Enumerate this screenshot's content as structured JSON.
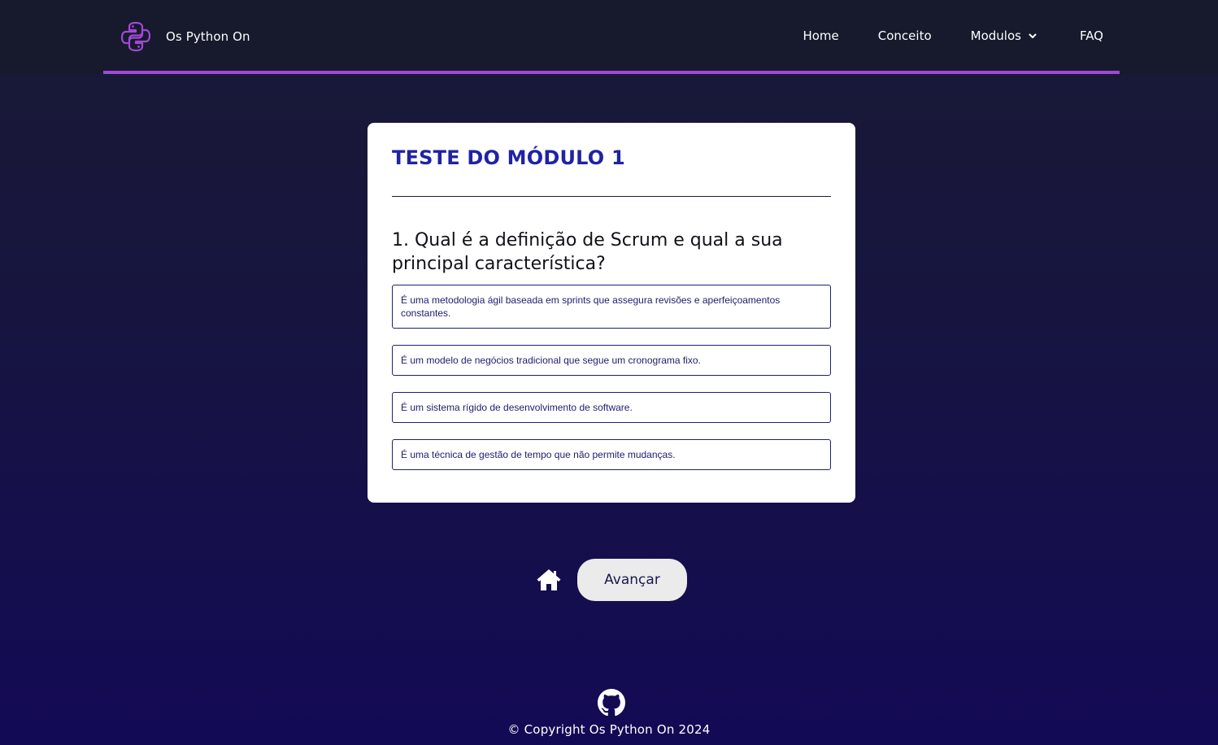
{
  "header": {
    "brand": "Os Python On",
    "nav": [
      {
        "label": "Home"
      },
      {
        "label": "Conceito"
      },
      {
        "label": "Modulos",
        "has_dropdown": true
      },
      {
        "label": "FAQ"
      }
    ]
  },
  "quiz": {
    "title": "TESTE DO MÓDULO 1",
    "question": "1. Qual é a definição de Scrum e qual a sua principal característica?",
    "options": [
      "É uma metodologia ágil baseada em sprints que assegura revisões e aperfeiçoamentos constantes.",
      "É um modelo de negócios tradicional que segue um cronograma fixo.",
      "É um sistema rígido de desenvolvimento de software.",
      "É uma técnica de gestão de tempo que não permite mudanças."
    ]
  },
  "actions": {
    "home_icon": "home-icon",
    "next_label": "Avançar"
  },
  "footer": {
    "github_icon": "github-icon",
    "copyright": "© Copyright Os Python On 2024"
  },
  "colors": {
    "accent": "#a148d6",
    "title": "#1f23a4",
    "navbar_bg": "#161a2c",
    "page_bg_top": "#191935",
    "page_bg_bottom": "#130a56"
  }
}
